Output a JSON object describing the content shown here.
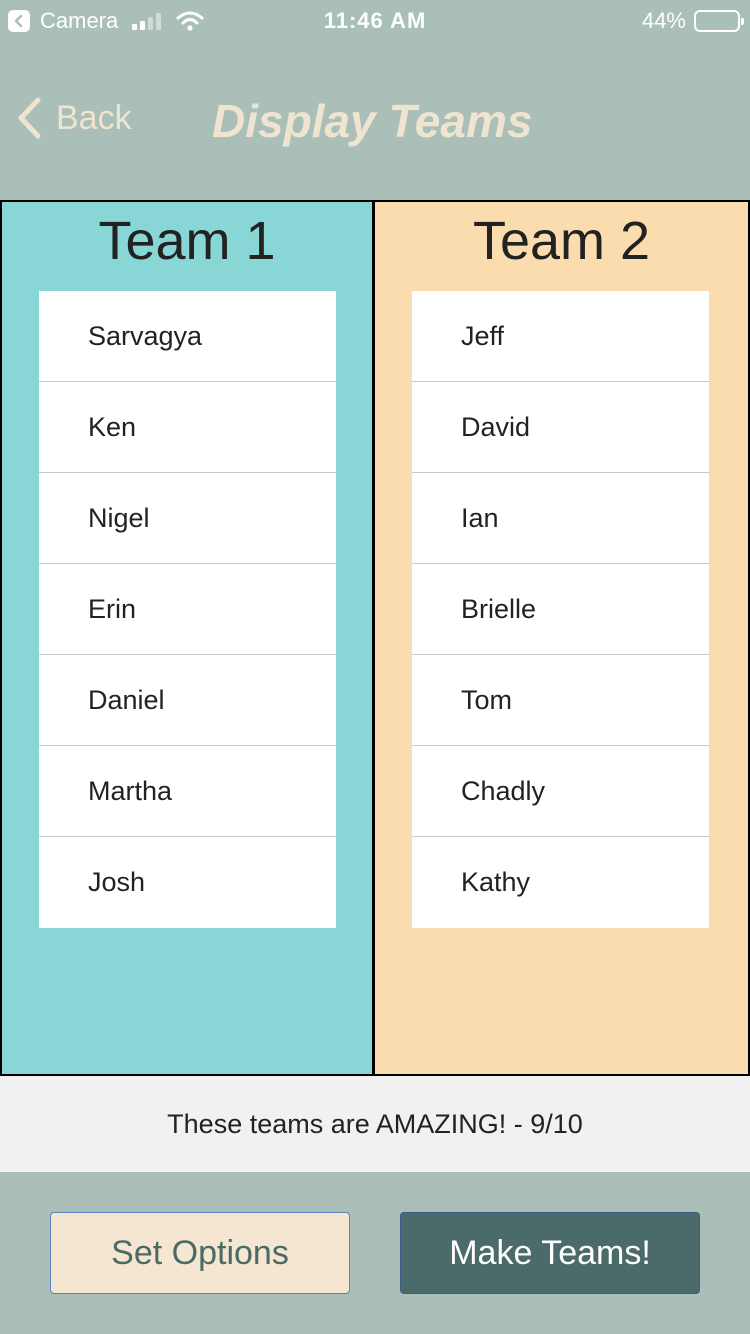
{
  "status_bar": {
    "back_app_label": "Camera",
    "time": "11:46 AM",
    "battery_percent": "44%",
    "battery_level": 0.44
  },
  "nav": {
    "back_label": "Back",
    "title": "Display Teams"
  },
  "teams": [
    {
      "title": "Team 1",
      "color": "#89d6d7",
      "members": [
        "Sarvagya",
        "Ken",
        "Nigel",
        "Erin",
        "Daniel",
        "Martha",
        "Josh"
      ]
    },
    {
      "title": "Team 2",
      "color": "#fbdcae",
      "members": [
        "Jeff",
        "David",
        "Ian",
        "Brielle",
        "Tom",
        "Chadly",
        "Kathy"
      ]
    }
  ],
  "rating": "These teams are AMAZING! - 9/10",
  "buttons": {
    "set_options": "Set Options",
    "make_teams": "Make Teams!"
  },
  "colors": {
    "background": "#aabfb8",
    "nav_text": "#efe4cf",
    "make_button": "#4a6b69",
    "options_button": "#f4e6d1"
  }
}
